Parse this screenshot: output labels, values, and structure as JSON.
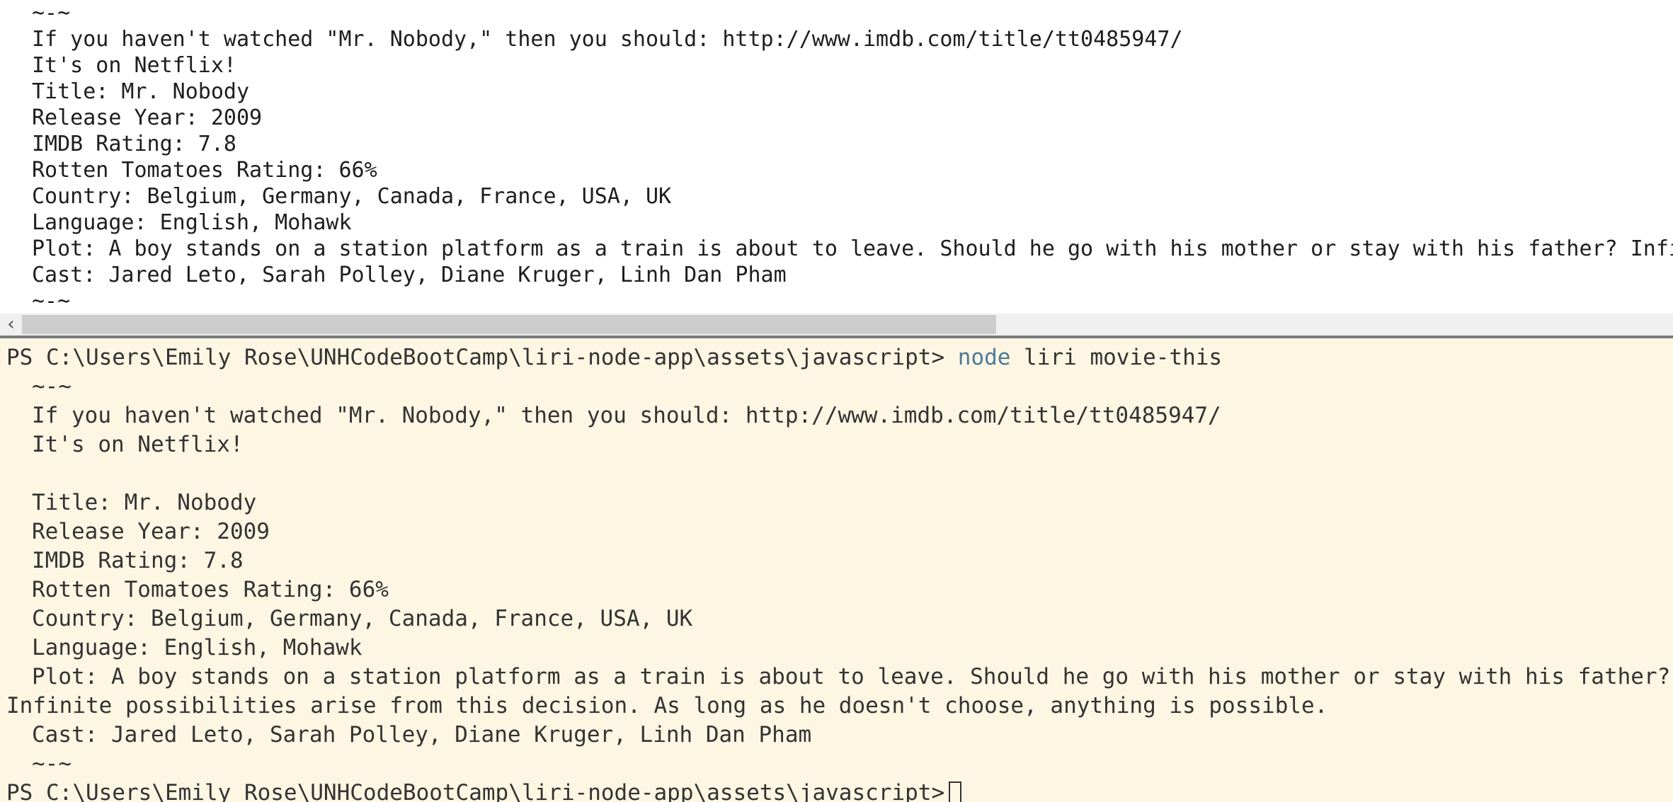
{
  "top_pane": {
    "lines": [
      "~-~",
      "If you haven't watched \"Mr. Nobody,\" then you should: http://www.imdb.com/title/tt0485947/",
      "It's on Netflix!",
      "Title: Mr. Nobody",
      "Release Year: 2009",
      "IMDB Rating: 7.8",
      "Rotten Tomatoes Rating: 66%",
      "Country: Belgium, Germany, Canada, France, USA, UK",
      "Language: English, Mohawk",
      "Plot: A boy stands on a station platform as a train is about to leave. Should he go with his mother or stay with his father? Infi",
      "Cast: Jared Leto, Sarah Polley, Diane Kruger, Linh Dan Pham",
      "~-~"
    ],
    "scroll_left_glyph": "‹"
  },
  "terminal": {
    "prompt": "PS C:\\Users\\Emily Rose\\UNHCodeBootCamp\\liri-node-app\\assets\\javascript>",
    "command_keyword": "node",
    "command_args": "liri movie-this",
    "output": {
      "sep_open": "~-~",
      "watch_line": "If you haven't watched \"Mr. Nobody,\" then you should: http://www.imdb.com/title/tt0485947/",
      "netflix_line": "It's on Netflix!",
      "title": "Title: Mr. Nobody",
      "release_year": "Release Year: 2009",
      "imdb_rating": "IMDB Rating: 7.8",
      "rt_rating": "Rotten Tomatoes Rating: 66%",
      "country": "Country: Belgium, Germany, Canada, France, USA, UK",
      "language": "Language: English, Mohawk",
      "plot_1": "Plot: A boy stands on a station platform as a train is about to leave. Should he go with his mother or stay with his father?",
      "plot_2": "Infinite possibilities arise from this decision. As long as he doesn't choose, anything is possible.",
      "cast": "Cast: Jared Leto, Sarah Polley, Diane Kruger, Linh Dan Pham",
      "sep_close": "~-~"
    },
    "final_prompt": "PS C:\\Users\\Emily Rose\\UNHCodeBootCamp\\liri-node-app\\assets\\javascript>"
  },
  "colors": {
    "terminal_bg": "#fdf6e3",
    "terminal_text": "#333333",
    "command_keyword": "#4c7a99",
    "top_bg": "#ffffff"
  }
}
